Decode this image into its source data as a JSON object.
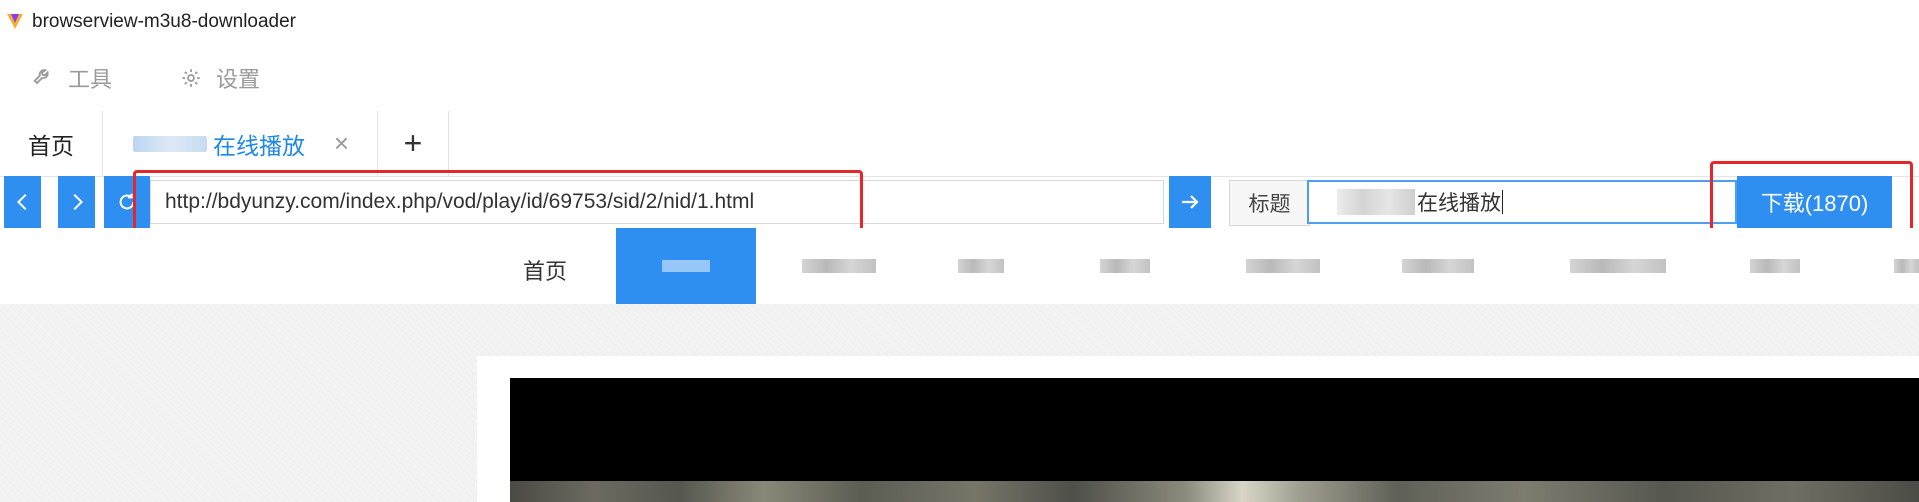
{
  "app": {
    "title": "browserview-m3u8-downloader"
  },
  "menu": {
    "tools_label": "工具",
    "settings_label": "设置"
  },
  "tabs": {
    "home_label": "首页",
    "active_label_suffix": "在线播放",
    "close_symbol": "×",
    "add_symbol": "+"
  },
  "nav": {
    "back_symbol": "<",
    "forward_symbol": ">",
    "url": "http://bdyunzy.com/index.php/vod/play/id/69753/sid/2/nid/1.html",
    "title_label": "标题",
    "title_value_suffix": "在线播放",
    "download_label": "下载(1870)"
  },
  "site_nav": {
    "home_label": "首页"
  },
  "colors": {
    "accent": "#2f8ff0",
    "highlight": "#e8252b",
    "tab_active_text": "#1e88e5"
  },
  "icons": [
    "app-logo-icon",
    "wrench-icon",
    "gear-icon",
    "close-icon",
    "plus-icon",
    "back-icon",
    "forward-icon",
    "refresh-icon",
    "arrow-right-icon"
  ]
}
